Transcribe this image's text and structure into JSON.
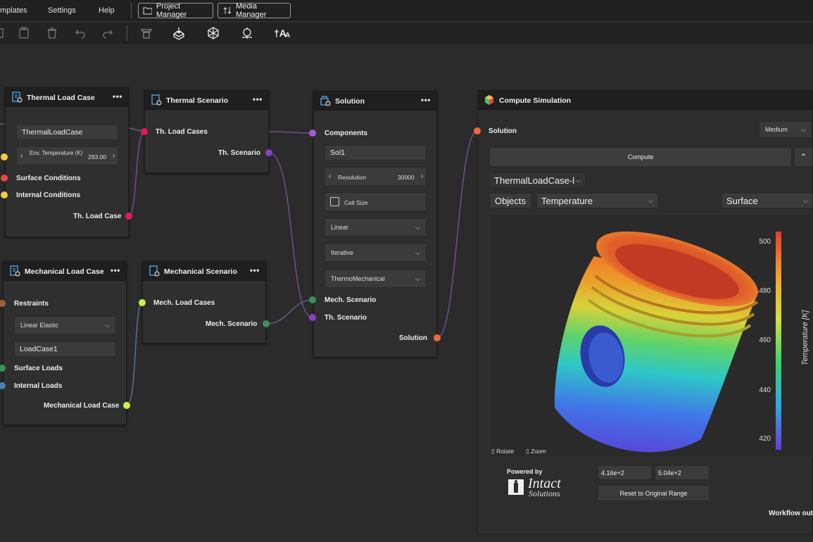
{
  "menu": {
    "templates": "mplates",
    "settings": "Settings",
    "help": "Help",
    "project_manager": "Project Manager",
    "media_manager": "Media Manager"
  },
  "thermal_load_case": {
    "title": "Thermal Load Case",
    "name_value": "ThermalLoadCase",
    "env_temp_label": "Env. Temperature (K)",
    "env_temp_value": "293.00",
    "surface_conditions": "Surface Conditions",
    "internal_conditions": "Internal Conditions",
    "output": "Th. Load Case"
  },
  "thermal_scenario": {
    "title": "Thermal Scenario",
    "input": "Th. Load Cases",
    "output": "Th. Scenario"
  },
  "solution": {
    "title": "Solution",
    "components": "Components",
    "name_value": "Sol1",
    "resolution_label": "Resolution",
    "resolution_value": "30000",
    "cell_size": "Cell Size",
    "dd1": "Linear",
    "dd2": "Iterative",
    "dd3": "ThermoMechanical",
    "mech_scenario": "Mech. Scenario",
    "th_scenario": "Th. Scenario",
    "output": "Solution"
  },
  "mechanical_load_case": {
    "title": "Mechanical Load Case",
    "restraints": "Restraints",
    "material_dd": "Linear Elastic",
    "name_value": "LoadCase1",
    "surface_loads": "Surface Loads",
    "internal_loads": "Internal Loads",
    "output": "Mechanical Load Case"
  },
  "mechanical_scenario": {
    "title": "Mechanical Scenario",
    "input": "Mech. Load Cases",
    "output": "Mech. Scenario"
  },
  "compute": {
    "title": "Compute Simulation",
    "input": "Solution",
    "quality": "Medium",
    "compute_btn": "Compute",
    "loadcase_select": "ThermalLoadCase-l",
    "objects_btn": "Objects",
    "field_select": "Temperature",
    "mode_select": "Surface",
    "colorbar_title": "Temperature [K]",
    "colorbar_ticks": [
      "500",
      "480",
      "460",
      "440",
      "420"
    ],
    "rotate": "Rotate",
    "zoom": "Zoom",
    "powered_by": "Powered by",
    "brand_name": "Intact",
    "brand_sub": "Solutions",
    "range_min": "4.16e+2",
    "range_max": "5.04e+2",
    "reset_btn": "Reset to Original Range",
    "workflow_out": "Workflow out"
  },
  "colors": {
    "accent_pink": "#e8175d",
    "accent_purple": "#8b3fc7",
    "accent_orange": "#f26a35",
    "accent_yellow": "#f2c94c",
    "accent_green": "#3f8f5a",
    "lime": "#c8f04a",
    "red": "#e84848",
    "teal": "#4b7fb0",
    "brown": "#a0623a"
  }
}
